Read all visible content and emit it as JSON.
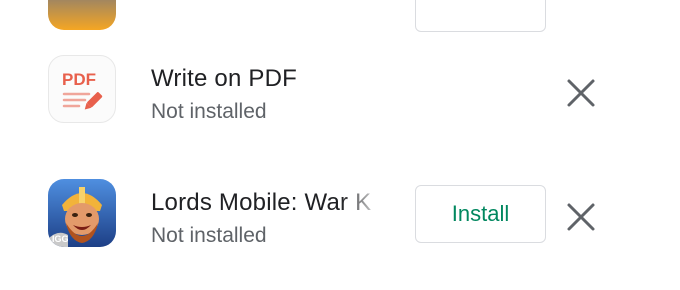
{
  "apps": [
    {
      "name": "Write on PDF",
      "status": "Not installed",
      "icon": "pdf-app-icon",
      "icon_text": "PDF",
      "has_install": false,
      "dismiss_icon": "close-icon"
    },
    {
      "name": "Lords Mobile: War K",
      "status": "Not installed",
      "icon": "lords-mobile-app-icon",
      "icon_text": "IGG",
      "has_install": true,
      "install_label": "Install",
      "dismiss_icon": "close-icon"
    }
  ],
  "colors": {
    "accent_green": "#01875f",
    "pdf_red": "#e8604c",
    "text_primary": "#202124",
    "text_secondary": "#5f6368",
    "close_icon": "#5f6368"
  }
}
